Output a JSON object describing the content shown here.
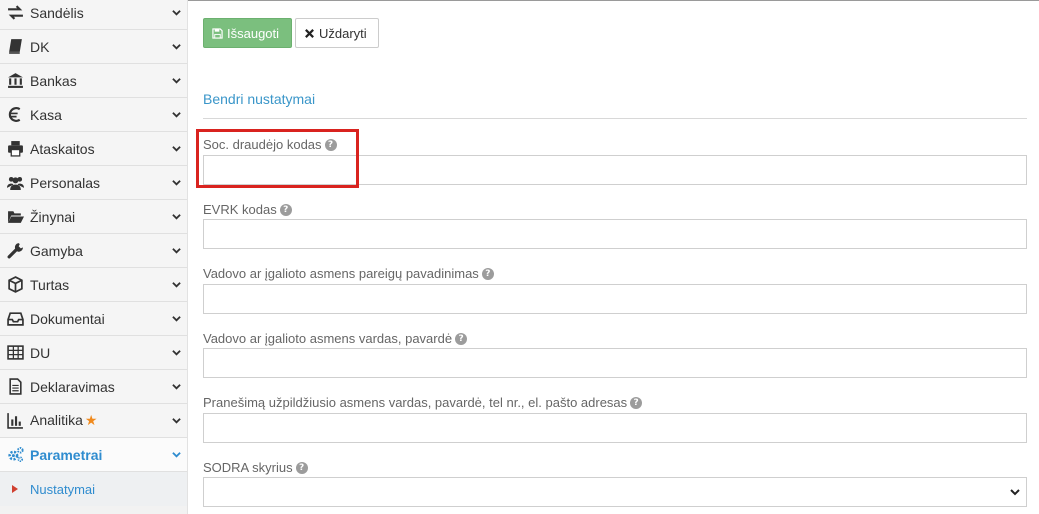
{
  "sidebar": {
    "items": [
      {
        "label": "Sandėlis",
        "icon": "exchange-icon"
      },
      {
        "label": "DK",
        "icon": "book-icon"
      },
      {
        "label": "Bankas",
        "icon": "bank-icon"
      },
      {
        "label": "Kasa",
        "icon": "euro-icon"
      },
      {
        "label": "Ataskaitos",
        "icon": "printer-icon"
      },
      {
        "label": "Personalas",
        "icon": "users-icon"
      },
      {
        "label": "Žinynai",
        "icon": "folder-open-icon"
      },
      {
        "label": "Gamyba",
        "icon": "wrench-icon"
      },
      {
        "label": "Turtas",
        "icon": "cube-icon"
      },
      {
        "label": "Dokumentai",
        "icon": "inbox-icon"
      },
      {
        "label": "DU",
        "icon": "table-icon"
      },
      {
        "label": "Deklaravimas",
        "icon": "document-icon"
      },
      {
        "label": "Analitika",
        "icon": "bar-chart-icon"
      },
      {
        "label": "Parametrai",
        "icon": "cogs-icon"
      }
    ],
    "active_item": "Parametrai",
    "sub_item": {
      "label": "Nustatymai"
    },
    "accent_color": "#2f8ccf",
    "star_color": "#f08a1d"
  },
  "toolbar": {
    "save_label": "Išsaugoti",
    "close_label": "Uždaryti",
    "save_color": "#7bbf7e"
  },
  "form": {
    "section_title": "Bendri nustatymai",
    "fields": [
      {
        "label": "Soc. draudėjo kodas",
        "value": ""
      },
      {
        "label": "EVRK kodas",
        "value": ""
      },
      {
        "label": "Vadovo ar įgalioto asmens pareigų pavadinimas",
        "value": ""
      },
      {
        "label": "Vadovo ar įgalioto asmens vardas, pavardė",
        "value": ""
      },
      {
        "label": "Pranešimą užpildžiusio asmens vardas, pavardė, tel nr., el. pašto adresas",
        "value": ""
      },
      {
        "label": "SODRA skyrius",
        "value": ""
      }
    ],
    "help_glyph": "?"
  },
  "highlight_color": "#d9231f"
}
